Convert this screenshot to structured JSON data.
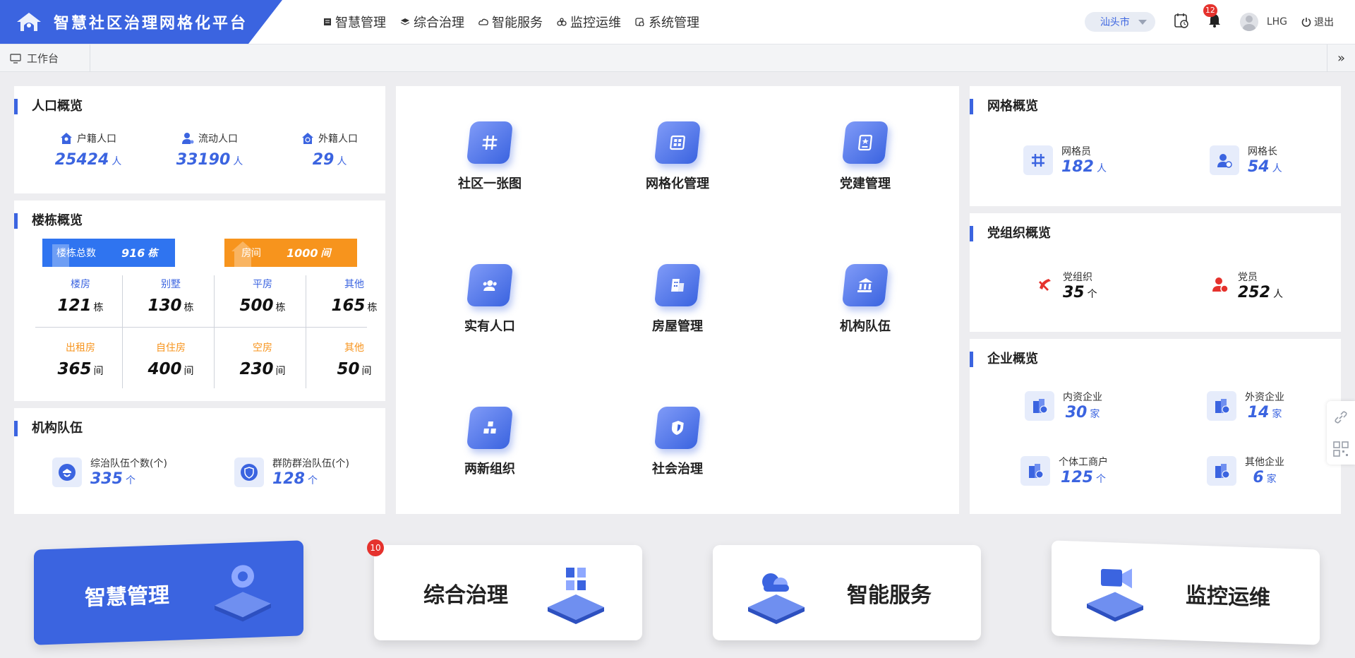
{
  "app": {
    "title": "智慧社区治理网格化平台"
  },
  "nav": [
    {
      "label": "智慧管理",
      "icon": "list-icon"
    },
    {
      "label": "综合治理",
      "icon": "layers-icon"
    },
    {
      "label": "智能服务",
      "icon": "cloud-icon"
    },
    {
      "label": "监控运维",
      "icon": "monitor-icon"
    },
    {
      "label": "系统管理",
      "icon": "settings-icon"
    }
  ],
  "header": {
    "city": "汕头市",
    "notification_count": "12",
    "user": "LHG",
    "logout": "退出"
  },
  "tabs": {
    "workbench": "工作台"
  },
  "population": {
    "title": "人口概览",
    "items": [
      {
        "label": "户籍人口",
        "value": "25424",
        "unit": "人"
      },
      {
        "label": "流动人口",
        "value": "33190",
        "unit": "人"
      },
      {
        "label": "外籍人口",
        "value": "29",
        "unit": "人"
      }
    ]
  },
  "buildings": {
    "title": "楼栋概览",
    "total_label": "楼栋总数",
    "total_value": "916",
    "total_unit": "栋",
    "rooms_label": "房间",
    "rooms_value": "1000",
    "rooms_unit": "间",
    "row1": [
      {
        "label": "楼房",
        "value": "121",
        "unit": "栋"
      },
      {
        "label": "别墅",
        "value": "130",
        "unit": "栋"
      },
      {
        "label": "平房",
        "value": "500",
        "unit": "栋"
      },
      {
        "label": "其他",
        "value": "165",
        "unit": "栋"
      }
    ],
    "row2": [
      {
        "label": "出租房",
        "value": "365",
        "unit": "间"
      },
      {
        "label": "自住房",
        "value": "400",
        "unit": "间"
      },
      {
        "label": "空房",
        "value": "230",
        "unit": "间"
      },
      {
        "label": "其他",
        "value": "50",
        "unit": "间"
      }
    ]
  },
  "org_team": {
    "title": "机构队伍",
    "items": [
      {
        "label": "综治队伍个数(个)",
        "value": "335",
        "unit": "个"
      },
      {
        "label": "群防群治队伍(个)",
        "value": "128",
        "unit": "个"
      }
    ]
  },
  "modules": [
    {
      "label": "社区一张图"
    },
    {
      "label": "网格化管理"
    },
    {
      "label": "党建管理"
    },
    {
      "label": "实有人口"
    },
    {
      "label": "房屋管理"
    },
    {
      "label": "机构队伍"
    },
    {
      "label": "两新组织"
    },
    {
      "label": "社会治理"
    }
  ],
  "grid": {
    "title": "网格概览",
    "items": [
      {
        "label": "网格员",
        "value": "182",
        "unit": "人"
      },
      {
        "label": "网格长",
        "value": "54",
        "unit": "人"
      }
    ]
  },
  "party": {
    "title": "党组织概览",
    "items": [
      {
        "label": "党组织",
        "value": "35",
        "unit": "个"
      },
      {
        "label": "党员",
        "value": "252",
        "unit": "人"
      }
    ]
  },
  "enterprise": {
    "title": "企业概览",
    "items": [
      {
        "label": "内资企业",
        "value": "30",
        "unit": "家"
      },
      {
        "label": "外资企业",
        "value": "14",
        "unit": "家"
      },
      {
        "label": "个体工商户",
        "value": "125",
        "unit": "个"
      },
      {
        "label": "其他企业",
        "value": "6",
        "unit": "家"
      }
    ]
  },
  "bottom": [
    {
      "label": "智慧管理"
    },
    {
      "label": "综合治理",
      "badge": "10"
    },
    {
      "label": "智能服务"
    },
    {
      "label": "监控运维"
    }
  ],
  "colors": {
    "primary": "#3b64e0",
    "orange": "#f7941d",
    "party_red": "#e5322d"
  }
}
